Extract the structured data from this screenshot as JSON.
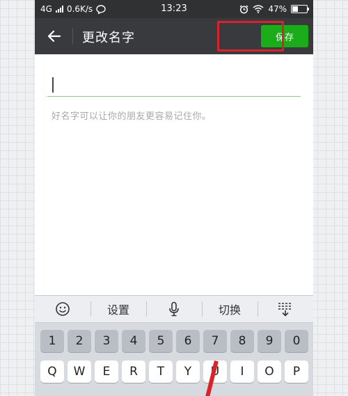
{
  "status_bar": {
    "network": "4G",
    "speed": "0.6K/s",
    "time": "13:23",
    "battery_percent": "47%",
    "battery_level": 0.47
  },
  "toolbar": {
    "title": "更改名字",
    "save_label": "保存"
  },
  "form": {
    "name_value": "",
    "hint": "好名字可以让你的朋友更容易记住你。"
  },
  "keyboard": {
    "settings_label": "设置",
    "switch_label": "切换",
    "number_row": [
      "1",
      "2",
      "3",
      "4",
      "5",
      "6",
      "7",
      "8",
      "9",
      "0"
    ],
    "letter_row": [
      "Q",
      "W",
      "E",
      "R",
      "T",
      "Y",
      "U",
      "I",
      "O",
      "P"
    ]
  },
  "colors": {
    "accent": "#1aad19",
    "toolbar_bg": "#393a3e",
    "highlight": "#d8232a"
  }
}
